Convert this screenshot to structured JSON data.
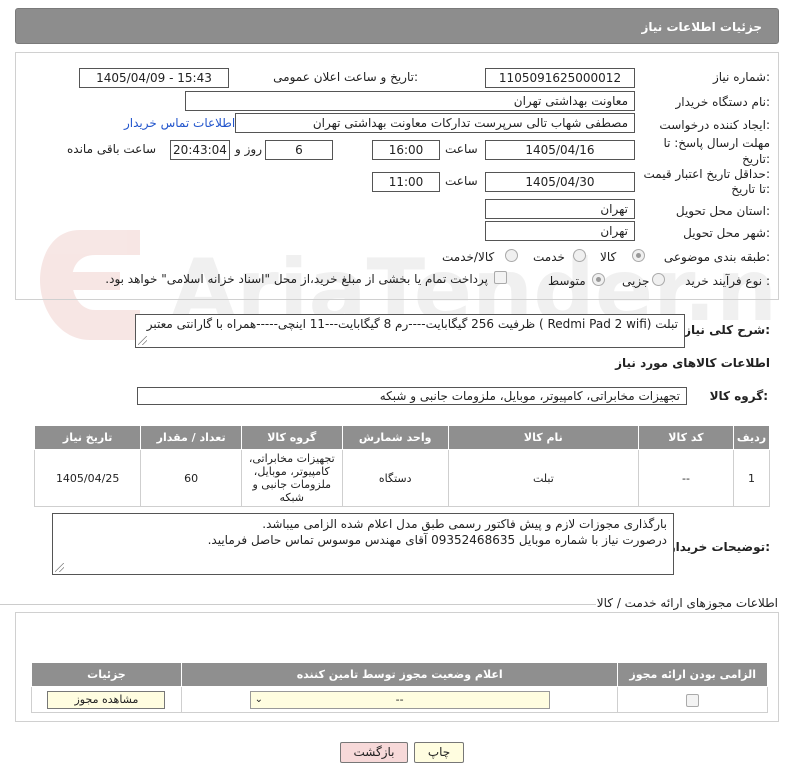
{
  "header": {
    "title": "جزئیات اطلاعات نیاز"
  },
  "form": {
    "need_number_label": "شماره نیاز:",
    "need_number": "1105091625000012",
    "announce_label": "تاریخ و ساعت اعلان عمومی:",
    "announce_value": "1405/04/09 - 15:43",
    "buyer_label": "نام دستگاه خریدار:",
    "buyer_value": "معاونت بهداشتی تهران",
    "creator_label": "ایجاد کننده درخواست:",
    "creator_value": "مصطفی شهاب تالی سرپرست تدارکات معاونت بهداشتی تهران",
    "contact_link": "اطلاعات تماس خریدار",
    "deadline_label_1": "مهلت ارسال پاسخ: تا",
    "deadline_label_2": "تاریخ:",
    "deadline_date": "1405/04/16",
    "hour_label": "ساعت",
    "deadline_time": "16:00",
    "days_value": "6",
    "days_label": "روز و",
    "remaining_value": "20:43:04",
    "remaining_label": "ساعت باقی مانده",
    "validity_label_1": "حداقل تاریخ اعتبار قیمت:",
    "validity_label_2": "تا تاریخ:",
    "validity_date": "1405/04/30",
    "validity_time": "11:00",
    "province_label": "استان محل تحویل:",
    "province_value": "تهران",
    "city_label": "شهر محل تحویل:",
    "city_value": "تهران",
    "category_label": "طبقه بندی موضوعی:",
    "category_options": [
      "کالا",
      "خدمت",
      "کالا/خدمت"
    ],
    "process_label": "نوع فرآیند خرید :",
    "process_options": [
      "جزیی",
      "متوسط"
    ],
    "payment_text": "پرداخت تمام یا بخشی از مبلغ خرید،از محل \"اسناد خزانه اسلامی\" خواهد بود."
  },
  "description": {
    "label": "شرح کلی نیاز:",
    "text": "تبلت (Redmi Pad 2 wifi ) ظرفیت 256 گیگابایت----رم 8 گیگابایت---11 اینچی-----همراه با گارانتی معتبر"
  },
  "goods": {
    "section_title": "اطلاعات کالاهای مورد نیاز",
    "group_label": "گروه کالا:",
    "group_value": "تجهیزات مخابراتی، کامپیوتر، موبایل، ملزومات جانبی و شبکه",
    "columns": [
      "ردیف",
      "کد کالا",
      "نام کالا",
      "واحد شمارش",
      "گروه کالا",
      "تعداد / مقدار",
      "تاریخ نیاز"
    ],
    "rows": [
      [
        "1",
        "--",
        "تبلت",
        "دستگاه",
        "تجهیزات مخابراتی، کامپیوتر، موبایل، ملزومات جانبی و شبکه",
        "60",
        "1405/04/25"
      ]
    ]
  },
  "buyer_notes": {
    "label": "توضیحات خریدار:",
    "line1": "بارگذاری مجوزات لازم و پیش فاکتور رسمی طبق مدل اعلام شده الزامی میباشد.",
    "line2": "درصورت نیاز با شماره موبایل 09352468635 آقای مهندس موسوس تماس حاصل فرمایید."
  },
  "licenses": {
    "section_title": "اطلاعات مجوزهای ارائه خدمت / کالا",
    "columns": [
      "الزامی بودن ارائه مجوز",
      "اعلام وضعیت مجوز توسط تامین کننده",
      "جزئیات"
    ],
    "status_value": "--",
    "view_button": "مشاهده مجوز"
  },
  "footer": {
    "print_button": "چاپ",
    "back_button": "بازگشت"
  },
  "watermark": {
    "text": "AriaTender.neT"
  },
  "colors": {
    "header_bg": "#8d8d8d",
    "link": "#2255cc",
    "field_highlight": "#fffde0",
    "back_button_bg": "#f7d9d9"
  }
}
